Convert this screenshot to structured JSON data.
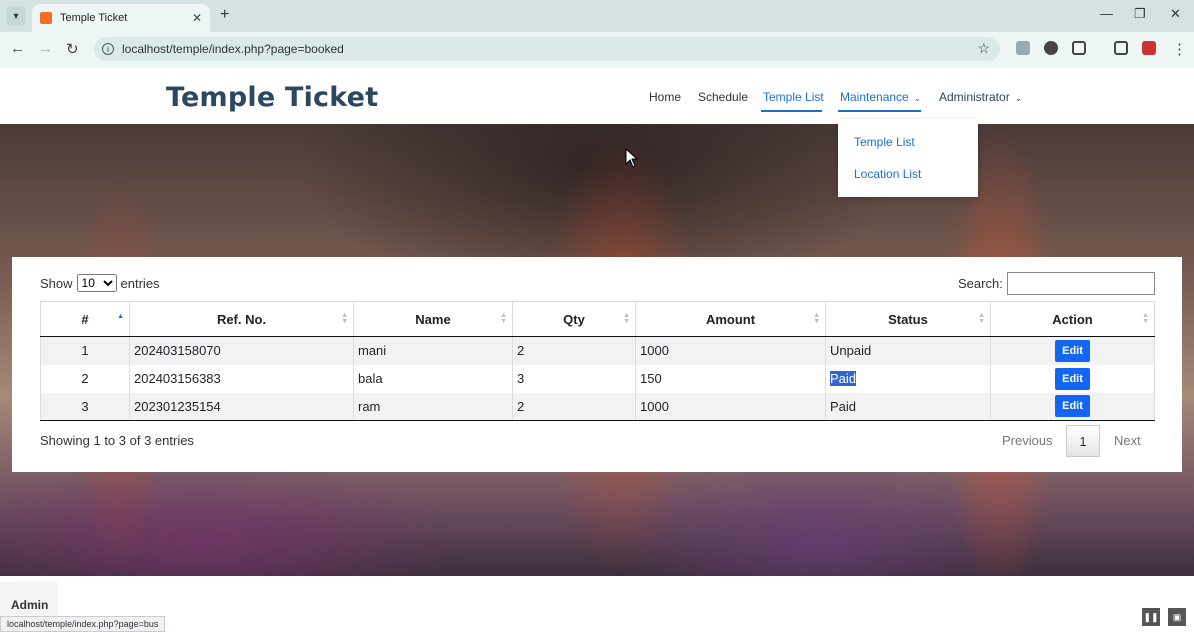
{
  "browser": {
    "tab_title": "Temple Ticket",
    "url": "localhost/temple/index.php?page=booked",
    "status_url": "localhost/temple/index.php?page=bus"
  },
  "site": {
    "brand": "Temple Ticket",
    "nav": [
      {
        "label": "Home"
      },
      {
        "label": "Schedule"
      },
      {
        "label": "Temple List"
      },
      {
        "label": "Maintenance"
      },
      {
        "label": "Administrator"
      }
    ],
    "dropdown": [
      "Temple List",
      "Location List"
    ]
  },
  "table_controls": {
    "show_prefix": "Show",
    "show_value": "10",
    "show_suffix": "entries",
    "search_label": "Search:"
  },
  "table": {
    "headers": [
      "#",
      "Ref. No.",
      "Name",
      "Qty",
      "Amount",
      "Status",
      "Action"
    ],
    "rows": [
      {
        "num": "1",
        "ref": "202403158070",
        "name": "mani",
        "qty": "2",
        "amount": "1000",
        "status": "Unpaid",
        "action": "Edit"
      },
      {
        "num": "2",
        "ref": "202403156383",
        "name": "bala",
        "qty": "3",
        "amount": "150",
        "status": "Paid",
        "action": "Edit"
      },
      {
        "num": "3",
        "ref": "202301235154",
        "name": "ram",
        "qty": "2",
        "amount": "1000",
        "status": "Paid",
        "action": "Edit"
      }
    ]
  },
  "pagination": {
    "info": "Showing 1 to 3 of 3 entries",
    "previous": "Previous",
    "current": "1",
    "next": "Next"
  },
  "footer": {
    "admin_label": "Admin"
  }
}
